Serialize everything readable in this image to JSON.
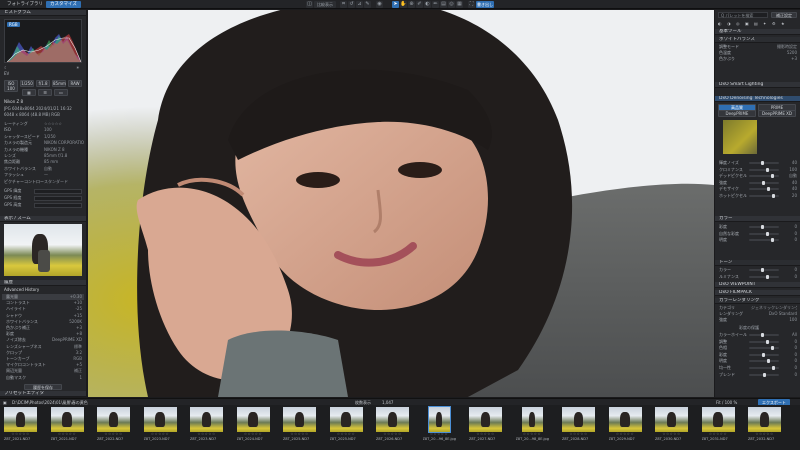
{
  "topbar": {
    "tab_photo_library": "フォトライブラリ",
    "tab_customize": "カスタマイズ",
    "buttons": [
      "比較表示",
      "ツール",
      "モード",
      "表示",
      "ヘルプ"
    ],
    "export_button": "書き出し"
  },
  "left": {
    "histogram_title": "ヒストグラム",
    "histogram_tab": "RGB",
    "exposure_label": "EV",
    "exposure_modes": [
      "ISO 100",
      "1/250",
      "f/1.8",
      "85mm",
      "RAW"
    ],
    "camera": "Nikon Z 8",
    "file_info": "JPG 6048x8064 2024/01/21 16:32",
    "file_size": "6048 x 8064 (48.8 MB) RGB",
    "meta_rows": [
      {
        "k": "レーティング",
        "v": "☆☆☆☆☆"
      },
      {
        "k": "ISO",
        "v": "100"
      },
      {
        "k": "シャッタースピード",
        "v": "1/250"
      },
      {
        "k": "カメラの製造元",
        "v": "NIKON CORPORATION"
      },
      {
        "k": "カメラの機種",
        "v": "NIKON Z 8"
      },
      {
        "k": "レンズ",
        "v": "85mm f/1.8"
      },
      {
        "k": "焦点距離",
        "v": "85 mm"
      },
      {
        "k": "ホワイトバランス",
        "v": "自動"
      },
      {
        "k": "フラッシュ",
        "v": "—"
      },
      {
        "k": "ピクチャーコントロール",
        "v": "スタンダード"
      }
    ],
    "gps_rows": [
      "GPS 緯度",
      "GPS 経度",
      "GPS 高度"
    ],
    "navigator_title": "表示 / ズーム",
    "history_title": "履歴",
    "advanced_history_title": "Advanced History",
    "history_items": [
      {
        "label": "露光量",
        "value": "+0.30"
      },
      {
        "label": "コントラスト",
        "value": "+10"
      },
      {
        "label": "ハイライト",
        "value": "-25"
      },
      {
        "label": "シャドウ",
        "value": "+15"
      },
      {
        "label": "ホワイトバランス",
        "value": "5200K"
      },
      {
        "label": "色かぶり補正",
        "value": "+3"
      },
      {
        "label": "彩度",
        "value": "+8"
      },
      {
        "label": "ノイズ除去",
        "value": "DeepPRIME XD"
      },
      {
        "label": "レンズシャープネス",
        "value": "標準"
      },
      {
        "label": "クロップ",
        "value": "3:2"
      },
      {
        "label": "トーンカーブ",
        "value": "RGB"
      },
      {
        "label": "マイクロコントラスト",
        "value": "+5"
      },
      {
        "label": "周辺光量",
        "value": "補正"
      },
      {
        "label": "自動マスク",
        "value": "1"
      }
    ],
    "apply_history_button": "履歴を保存",
    "presets_title": "プリセットエディタ"
  },
  "right": {
    "search_placeholder": "Q  パレットを検索",
    "preset_button": "補正設定",
    "basic_title": "基本ツール",
    "wb_title": "ホワイトバランス",
    "wb_rows": [
      {
        "k": "調整モード",
        "v": "撮影時設定"
      },
      {
        "k": "色温度",
        "v": "5200"
      },
      {
        "k": "色かぶり",
        "v": "+3"
      }
    ],
    "smart_lighting_title": "DxO Smart Lighting",
    "denoise_title": "DxO Denoising Technologies",
    "denoise_modes": [
      "高品質",
      "PRIME",
      "DeepPRIME",
      "DeepPRIME XD"
    ],
    "denoise_sliders": [
      {
        "k": "輝度ノイズ",
        "v": "40"
      },
      {
        "k": "クロミナンス",
        "v": "100"
      },
      {
        "k": "デッドピクセル",
        "v": "自動"
      },
      {
        "k": "強度",
        "v": "40"
      },
      {
        "k": "デモザイク",
        "v": "40"
      },
      {
        "k": "ホットピクセル",
        "v": "20"
      }
    ],
    "color_title": "カラー",
    "color_rows": [
      {
        "k": "彩度",
        "v": "0"
      },
      {
        "k": "自然な彩度",
        "v": "0"
      },
      {
        "k": "明度",
        "v": "0"
      }
    ],
    "tone_title": "トーン",
    "tone_rows": [
      {
        "k": "カラー",
        "v": "0"
      },
      {
        "k": "ルミナンス",
        "v": "0"
      }
    ],
    "viewpoint_title": "DxO VIEWPOINT",
    "filmpack_title": "DxO FILMPACK",
    "color_rendering_title": "カラーレンダリング",
    "cr_rows": [
      {
        "k": "カテゴリ",
        "v": "ジェネリックレンダリング"
      },
      {
        "k": "レンダリング",
        "v": "DxO Standard"
      },
      {
        "k": "強度",
        "v": "100"
      }
    ],
    "protect_title": "彩度の保護",
    "hsl_rows": [
      {
        "k": "カラーホイール",
        "v": "All"
      },
      {
        "k": "調整",
        "v": "0"
      },
      {
        "k": "色相",
        "v": "0"
      },
      {
        "k": "彩度",
        "v": "0"
      },
      {
        "k": "明度",
        "v": "0"
      },
      {
        "k": "均一性",
        "v": "0"
      },
      {
        "k": "ブレンド",
        "v": "0"
      }
    ]
  },
  "filmbar": {
    "path": "D:\\DCIM\\Photos\\2024\\01\\風景\\春の黄色",
    "count_label": "枚数表示",
    "count_value": "1,047",
    "zoom_label": "Fit / 100 %",
    "export_button": "エクスポート"
  },
  "thumbs": [
    {
      "name": "Z8T_2021-ND7",
      "portrait": false
    },
    {
      "name": "Z8T_2021-ND7",
      "portrait": false
    },
    {
      "name": "Z8T_2022-ND7",
      "portrait": false
    },
    {
      "name": "Z8T_2023-ND7",
      "portrait": false
    },
    {
      "name": "Z8T_2023-ND7",
      "portrait": false
    },
    {
      "name": "Z8T_2024-ND7",
      "portrait": false
    },
    {
      "name": "Z8T_2025-ND7",
      "portrait": false
    },
    {
      "name": "Z8T_2025-ND7",
      "portrait": false
    },
    {
      "name": "Z8T_2026-ND7",
      "portrait": false
    },
    {
      "name": "Z8T_20...96_8E.jpg",
      "portrait": true
    },
    {
      "name": "Z8T_2027-ND7",
      "portrait": false
    },
    {
      "name": "Z8T_20...98_8E.jpg",
      "portrait": true
    },
    {
      "name": "Z8T_2028-ND7",
      "portrait": false
    },
    {
      "name": "Z8T_2029-ND7",
      "portrait": false
    },
    {
      "name": "Z8T_2030-ND7",
      "portrait": false
    },
    {
      "name": "Z8T_2031-ND7",
      "portrait": false
    },
    {
      "name": "Z8T_2032-ND7",
      "portrait": false
    }
  ],
  "rating_stars": "☆☆☆☆☆",
  "colors": {
    "accent": "#2f6fb3",
    "panel": "#26272a",
    "header": "#303237"
  }
}
